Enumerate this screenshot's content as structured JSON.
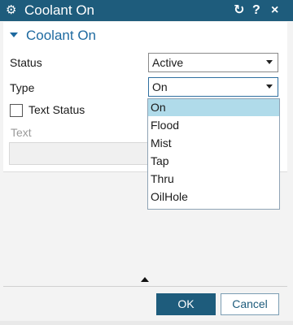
{
  "window": {
    "title": "Coolant On",
    "icon": "gear-icon",
    "reset_icon": "↻",
    "help_label": "?",
    "close_label": "×"
  },
  "group": {
    "title": "Coolant On",
    "expanded": true
  },
  "status": {
    "label": "Status",
    "value": "Active"
  },
  "type": {
    "label": "Type",
    "value": "On",
    "options": [
      "On",
      "Flood",
      "Mist",
      "Tap",
      "Thru",
      "OilHole"
    ],
    "selected_index": 0
  },
  "text_status": {
    "label": "Text Status",
    "checked": false
  },
  "text": {
    "label": "Text",
    "value": "",
    "enabled": false
  },
  "footer": {
    "ok_label": "OK",
    "cancel_label": "Cancel"
  },
  "colors": {
    "titlebar": "#1e5c7c",
    "accent": "#1e6aa0",
    "selected_item": "#b0dbea"
  }
}
